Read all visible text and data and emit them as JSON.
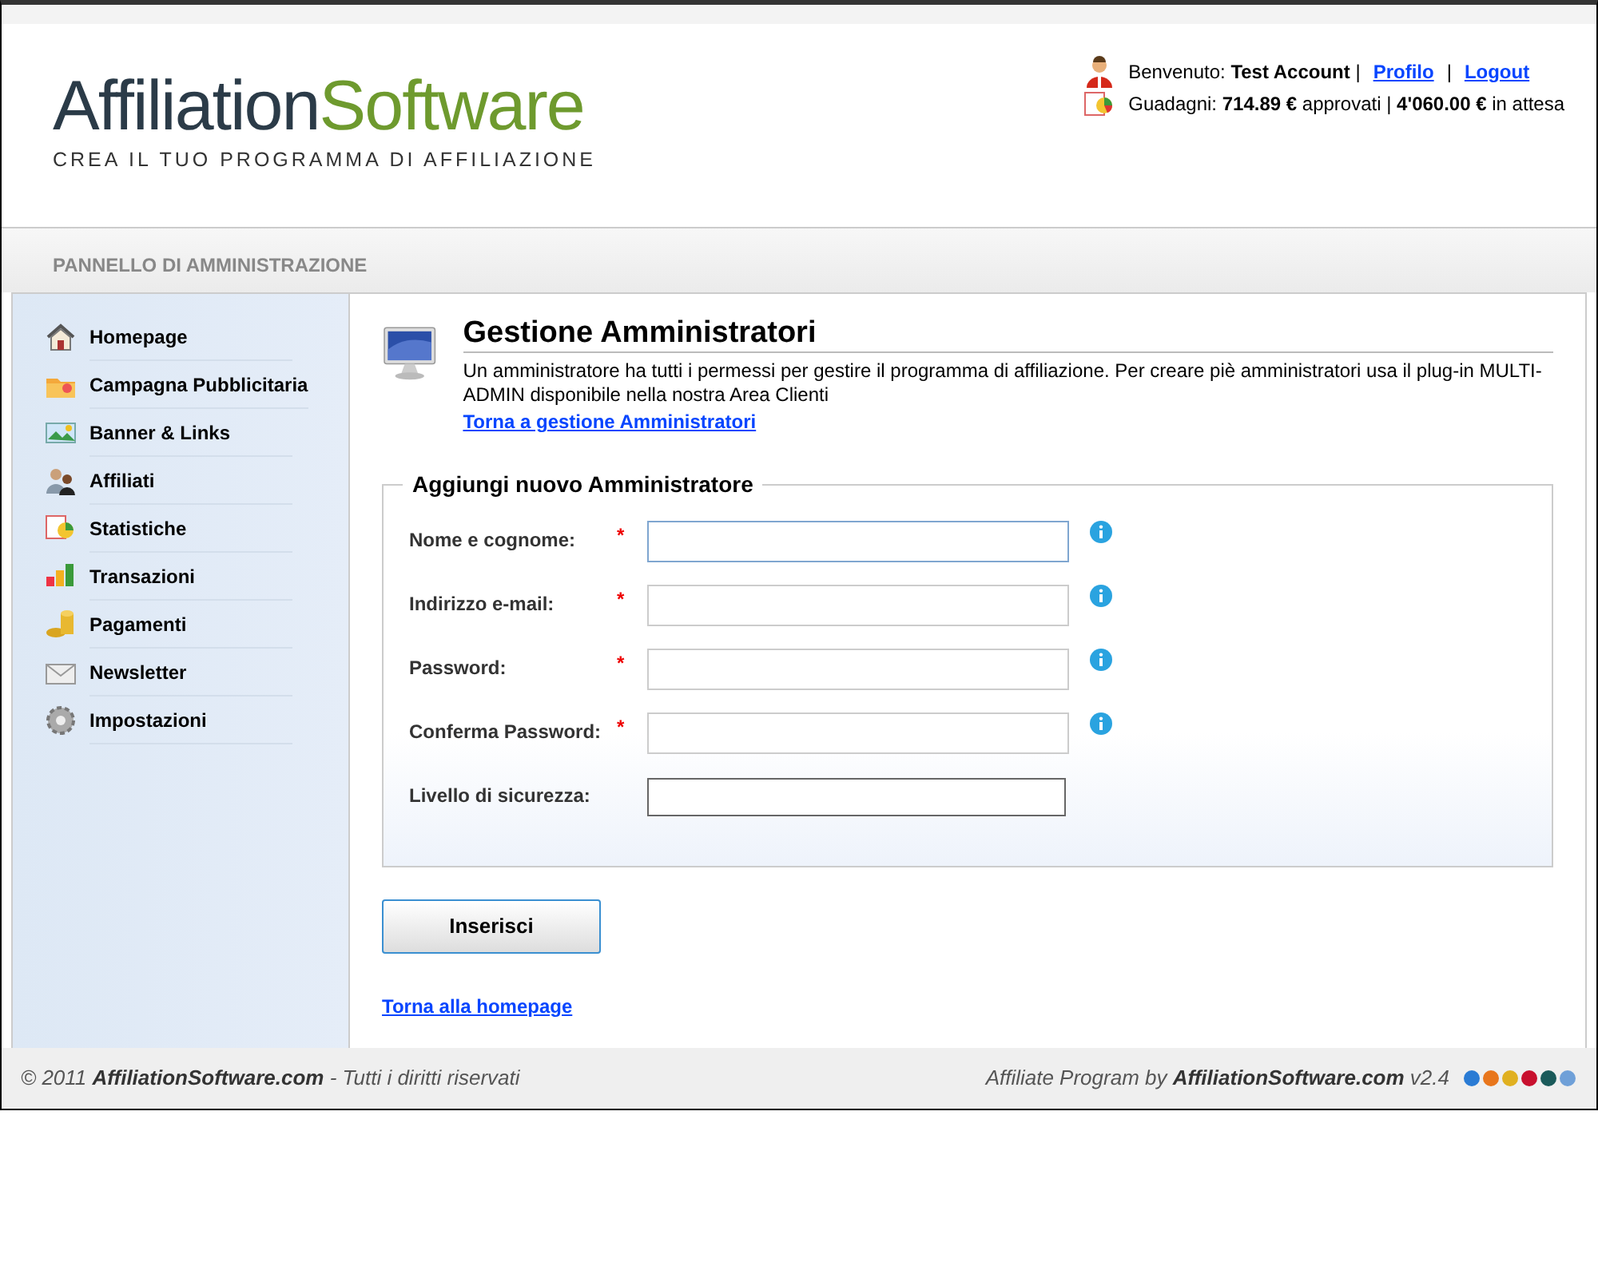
{
  "logo": {
    "title_part1": "Affiliation",
    "title_part2": "Software",
    "tagline": "CREA IL TUO PROGRAMMA DI AFFILIAZIONE"
  },
  "user_info": {
    "welcome": "Benvenuto: **Test Account** |",
    "profile_link": "Profilo",
    "separator": "|",
    "logout_link": "Logout",
    "earnings": "Guadagni: **714.89 €** approvati | **4'060.00 €** in attesa"
  },
  "panel_title": "PANNELLO DI AMMINISTRAZIONE",
  "sidebar": {
    "items": [
      {
        "label": "Homepage"
      },
      {
        "label": "Campagna Pubblicitaria"
      },
      {
        "label": "Banner & Links"
      },
      {
        "label": "Affiliati"
      },
      {
        "label": "Statistiche"
      },
      {
        "label": "Transazioni"
      },
      {
        "label": "Pagamenti"
      },
      {
        "label": "Newsletter"
      },
      {
        "label": "Impostazioni"
      }
    ]
  },
  "page": {
    "title": "Gestione Amministratori",
    "description": "Un amministratore ha tutti i permessi per gestire il programma di affiliazione. Per creare piè amministratori usa il plug-in MULTI-ADMIN disponibile nella nostra Area Clienti",
    "back_link": "Torna a gestione Amministratori"
  },
  "form": {
    "legend": "Aggiungi nuovo Amministratore",
    "fields": [
      {
        "label": "Nome e cognome:",
        "required_mark": "*",
        "info": true,
        "kind": "text",
        "focused": true
      },
      {
        "label": "Indirizzo e-mail:",
        "required_mark": "*",
        "info": true,
        "kind": "text",
        "focused": false
      },
      {
        "label": "Password:",
        "required_mark": "*",
        "info": true,
        "kind": "password",
        "focused": false
      },
      {
        "label": "Conferma Password:",
        "required_mark": "*",
        "info": true,
        "kind": "password",
        "focused": false
      },
      {
        "label": "Livello di sicurezza:",
        "info": false,
        "kind": "meter",
        "focused": false
      }
    ],
    "submit": "Inserisci"
  },
  "home_link": "Torna alla homepage",
  "footer": {
    "left": "© 2011 **AffiliationSoftware.com** - Tutti i diritti riservati",
    "right": "Affiliate Program by **AffiliationSoftware.com** v2.4"
  }
}
